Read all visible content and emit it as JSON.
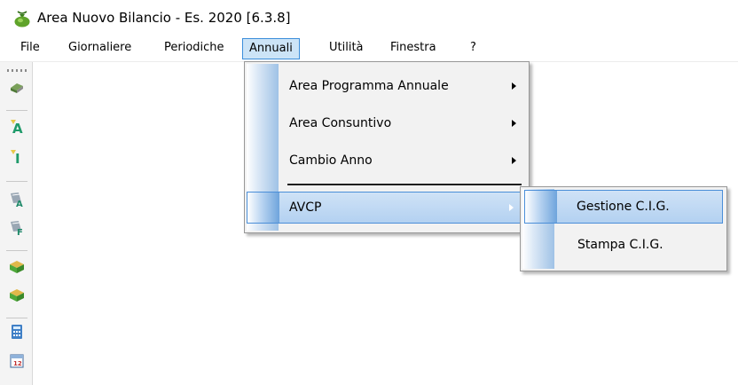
{
  "window": {
    "title": "Area Nuovo Bilancio - Es. 2020 [6.3.8]"
  },
  "menubar": {
    "items": [
      {
        "label": "File"
      },
      {
        "label": "Giornaliere"
      },
      {
        "label": "Periodiche"
      },
      {
        "label": "Annuali"
      },
      {
        "label": "Utilità"
      },
      {
        "label": "Finestra"
      },
      {
        "label": "?"
      }
    ],
    "active": "Annuali"
  },
  "annuali_menu": {
    "items": [
      {
        "label": "Area Programma Annuale",
        "submenu": true
      },
      {
        "label": "Area Consuntivo",
        "submenu": true
      },
      {
        "label": "Cambio Anno",
        "submenu": true
      },
      {
        "label": "AVCP",
        "submenu": true,
        "highlighted": true
      }
    ]
  },
  "avcp_submenu": {
    "items": [
      {
        "label": "Gestione C.I.G.",
        "highlighted": true
      },
      {
        "label": "Stampa C.I.G."
      }
    ]
  },
  "toolbar": {
    "icons": [
      "books-icon",
      "letter-a-icon",
      "letter-i-icon",
      "document-a-icon",
      "document-f-icon",
      "green-box-icon",
      "green-box-icon",
      "calculator-icon",
      "calendar-icon"
    ]
  }
}
